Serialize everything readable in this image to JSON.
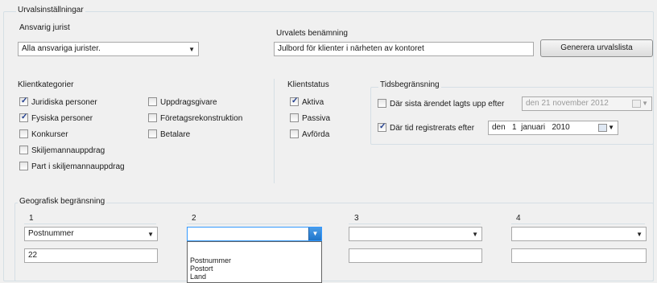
{
  "main_group": {
    "title": "Urvalsinställningar"
  },
  "responsible": {
    "label": "Ansvarig jurist",
    "value": "Alla ansvariga jurister."
  },
  "selection_name": {
    "label": "Urvalets benämning",
    "value": "Julbord för klienter i närheten av kontoret"
  },
  "generate_button": {
    "label": "Generera urvalslista"
  },
  "client_categories": {
    "title": "Klientkategorier",
    "items": [
      {
        "label": "Juridiska personer",
        "checked": true
      },
      {
        "label": "Fysiska personer",
        "checked": true
      },
      {
        "label": "Konkurser",
        "checked": false
      },
      {
        "label": "Skiljemannauppdrag",
        "checked": false
      },
      {
        "label": "Part i skiljemannauppdrag",
        "checked": false
      },
      {
        "label": "Uppdragsgivare",
        "checked": false
      },
      {
        "label": "Företagsrekonstruktion",
        "checked": false
      },
      {
        "label": "Betalare",
        "checked": false
      }
    ]
  },
  "client_status": {
    "title": "Klientstatus",
    "items": [
      {
        "label": "Aktiva",
        "checked": true
      },
      {
        "label": "Passiva",
        "checked": false
      },
      {
        "label": "Avförda",
        "checked": false
      }
    ]
  },
  "time_limit": {
    "title": "Tidsbegränsning",
    "last_case": {
      "label": "Där sista ärendet lagts upp efter",
      "checked": false,
      "date_text": "den 21 november 2012",
      "enabled": false
    },
    "registered": {
      "label": "Där tid registrerats efter",
      "checked": true,
      "date_text": "den   1  januari   2010",
      "enabled": true
    }
  },
  "geo": {
    "title": "Geografisk begränsning",
    "columns": [
      {
        "number": "1",
        "combo_value": "Postnummer",
        "text_value": "22"
      },
      {
        "number": "2",
        "combo_value": "",
        "text_value": ""
      },
      {
        "number": "3",
        "combo_value": "",
        "text_value": ""
      },
      {
        "number": "4",
        "combo_value": "",
        "text_value": ""
      }
    ],
    "dropdown_options": [
      "Postnummer",
      "Postort",
      "Land"
    ]
  }
}
